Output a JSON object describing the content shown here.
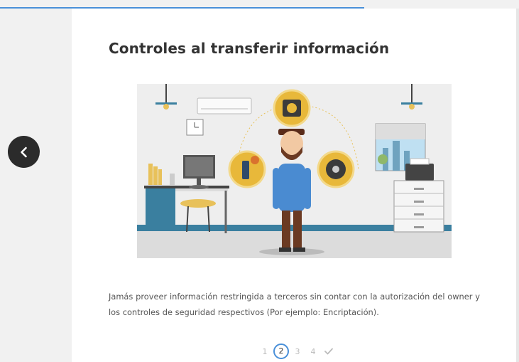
{
  "lesson": {
    "title": "Controles al transferir información",
    "body": "Jamás proveer información restringida a terceros sin contar con la autorización del owner y los controles de seguridad respectivos (Por ejemplo: Encriptación).",
    "illustration": "office-data-transfer-illustration"
  },
  "navigation": {
    "back_icon": "chevron-left-icon",
    "pages": [
      "1",
      "2",
      "3",
      "4"
    ],
    "current_page": 2,
    "complete_icon": "check-icon"
  },
  "colors": {
    "accent": "#4a90d9",
    "back_button": "#2b2b2b",
    "title": "#333333",
    "body_text": "#555555",
    "icon_circle": "#e8b83a"
  }
}
